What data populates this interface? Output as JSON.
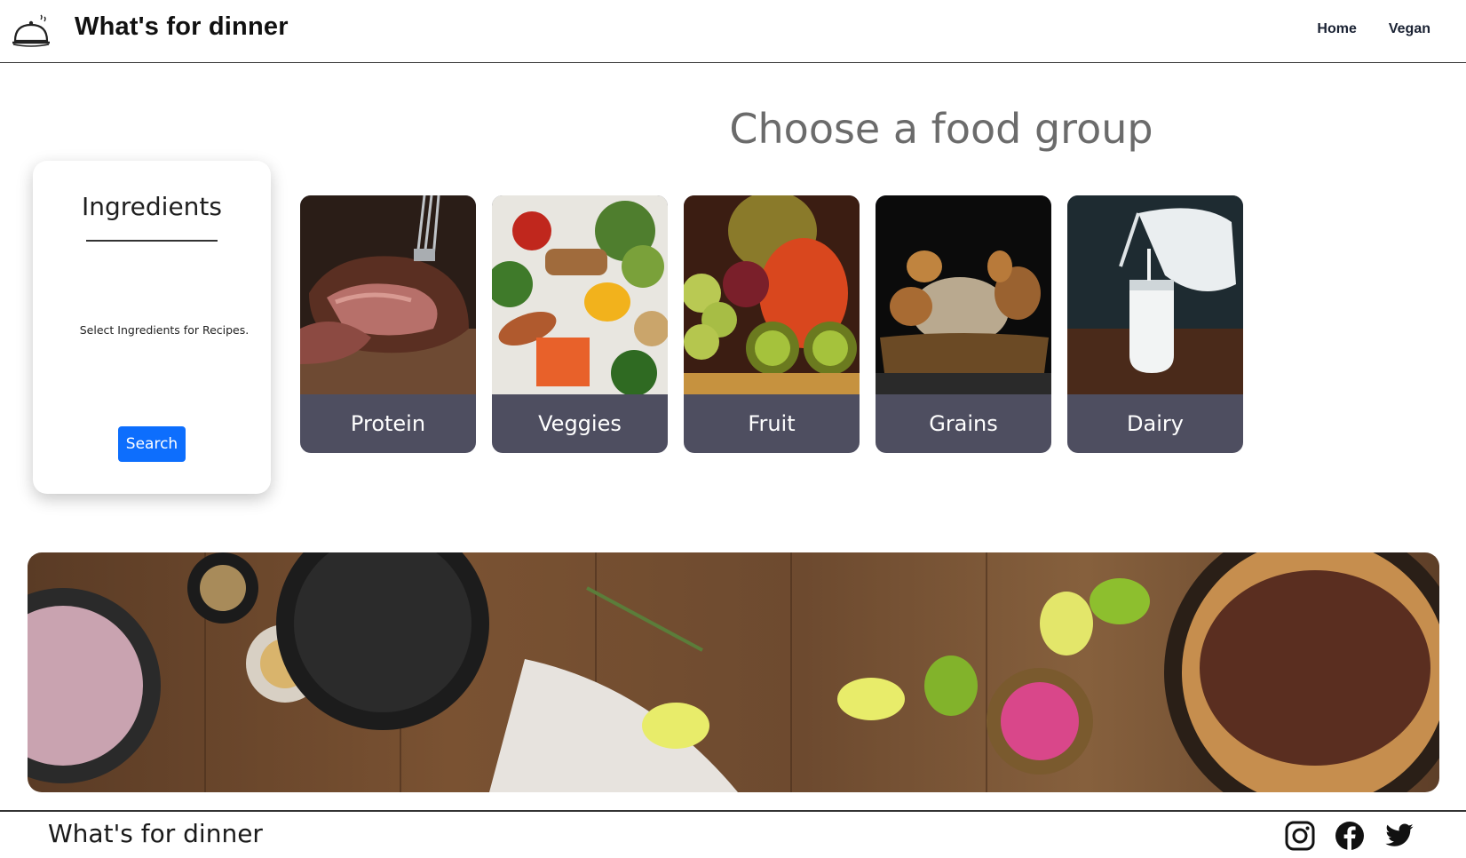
{
  "header": {
    "brand": "What's for dinner",
    "logo_icon": "cloche-icon",
    "nav": [
      {
        "label": "Home"
      },
      {
        "label": "Vegan"
      }
    ]
  },
  "main": {
    "section_title": "Choose a food group",
    "ingredients": {
      "title": "Ingredients",
      "prompt": "Select Ingredients for Recipes.",
      "search_label": "Search",
      "search_color": "#0d6efd"
    },
    "food_groups": [
      {
        "label": "Protein"
      },
      {
        "label": "Veggies"
      },
      {
        "label": "Fruit"
      },
      {
        "label": "Grains"
      },
      {
        "label": "Dairy"
      }
    ],
    "card_label_bg": "#4e4e60"
  },
  "footer": {
    "brand": "What's for dinner",
    "social_icons": [
      "instagram-icon",
      "facebook-icon",
      "twitter-icon"
    ]
  }
}
